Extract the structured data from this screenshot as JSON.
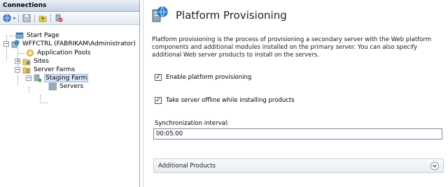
{
  "connections": {
    "header": "Connections",
    "toolbar": [
      "globe-connect-icon",
      "save-icon",
      "folder-up-icon",
      "server-disconnect-icon"
    ],
    "tree": [
      {
        "label": "Start Page"
      },
      {
        "label": "WFFCTRL (FABRIKAM\\Administrator)"
      },
      {
        "label": "Application Pools"
      },
      {
        "label": "Sites"
      },
      {
        "label": "Server Farms"
      },
      {
        "label": "Staging Farm"
      },
      {
        "label": "Servers"
      }
    ]
  },
  "main": {
    "title": "Platform Provisioning",
    "description": "Platform provisioning is the process of provisioning a secondary server with the Web platform components and additional modules installed on the primary server. You can also specify additional Web server products to install on the servers.",
    "enable_provisioning": {
      "label": "Enable platform provisioning",
      "checked": true
    },
    "take_offline": {
      "label": "Take server offline while installing products",
      "checked": true
    },
    "sync_interval": {
      "label": "Synchronization interval:",
      "value": "00:05:00"
    },
    "additional_products": {
      "label": "Additional Products"
    }
  },
  "colors": {
    "selection": "#d7e4f5",
    "header_gradient": "#c7d4e6"
  }
}
